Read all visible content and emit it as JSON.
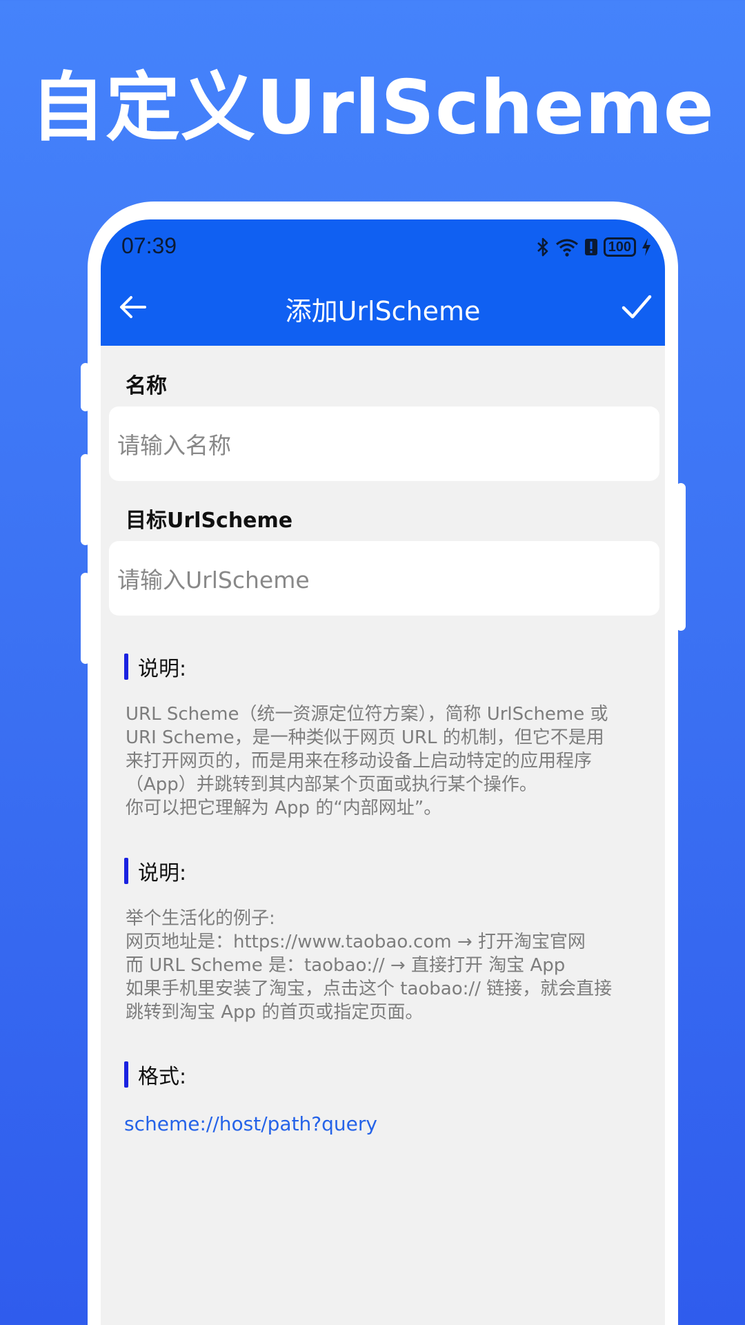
{
  "page": {
    "title": "自定义UrlScheme"
  },
  "status_bar": {
    "time": "07:39",
    "battery": "100"
  },
  "header": {
    "title": "添加UrlScheme"
  },
  "form": {
    "name_label": "名称",
    "name_placeholder": "请输入名称",
    "scheme_label": "目标UrlScheme",
    "scheme_placeholder": "请输入UrlScheme"
  },
  "sections": [
    {
      "title": "说明:",
      "body": "URL Scheme（统一资源定位符方案），简称 UrlScheme 或\nURI Scheme，是一种类似于网页 URL 的机制，但它不是用\n来打开网页的，而是用来在移动设备上启动特定的应用程序\n（App）并跳转到其内部某个页面或执行某个操作。\n你可以把它理解为 App 的“内部网址”。"
    },
    {
      "title": "说明:",
      "body": "举个生活化的例子:\n网页地址是：https://www.taobao.com → 打开淘宝官网\n而 URL Scheme 是：taobao:// → 直接打开 淘宝 App\n如果手机里安装了淘宝，点击这个 taobao:// 链接，就会直接\n跳转到淘宝 App 的首页或指定页面。"
    },
    {
      "title": "格式:",
      "body": "scheme://host/path?query"
    }
  ],
  "icons": {
    "back": "arrow-left-icon",
    "confirm": "check-icon",
    "bluetooth": "bluetooth-icon",
    "wifi": "wifi-icon",
    "alert": "alert-icon",
    "charging": "charging-icon"
  },
  "colors": {
    "background": "#3a6ff2",
    "header": "#1060f2",
    "accent_bar": "#1a22e0",
    "format_text": "#2563e8"
  }
}
